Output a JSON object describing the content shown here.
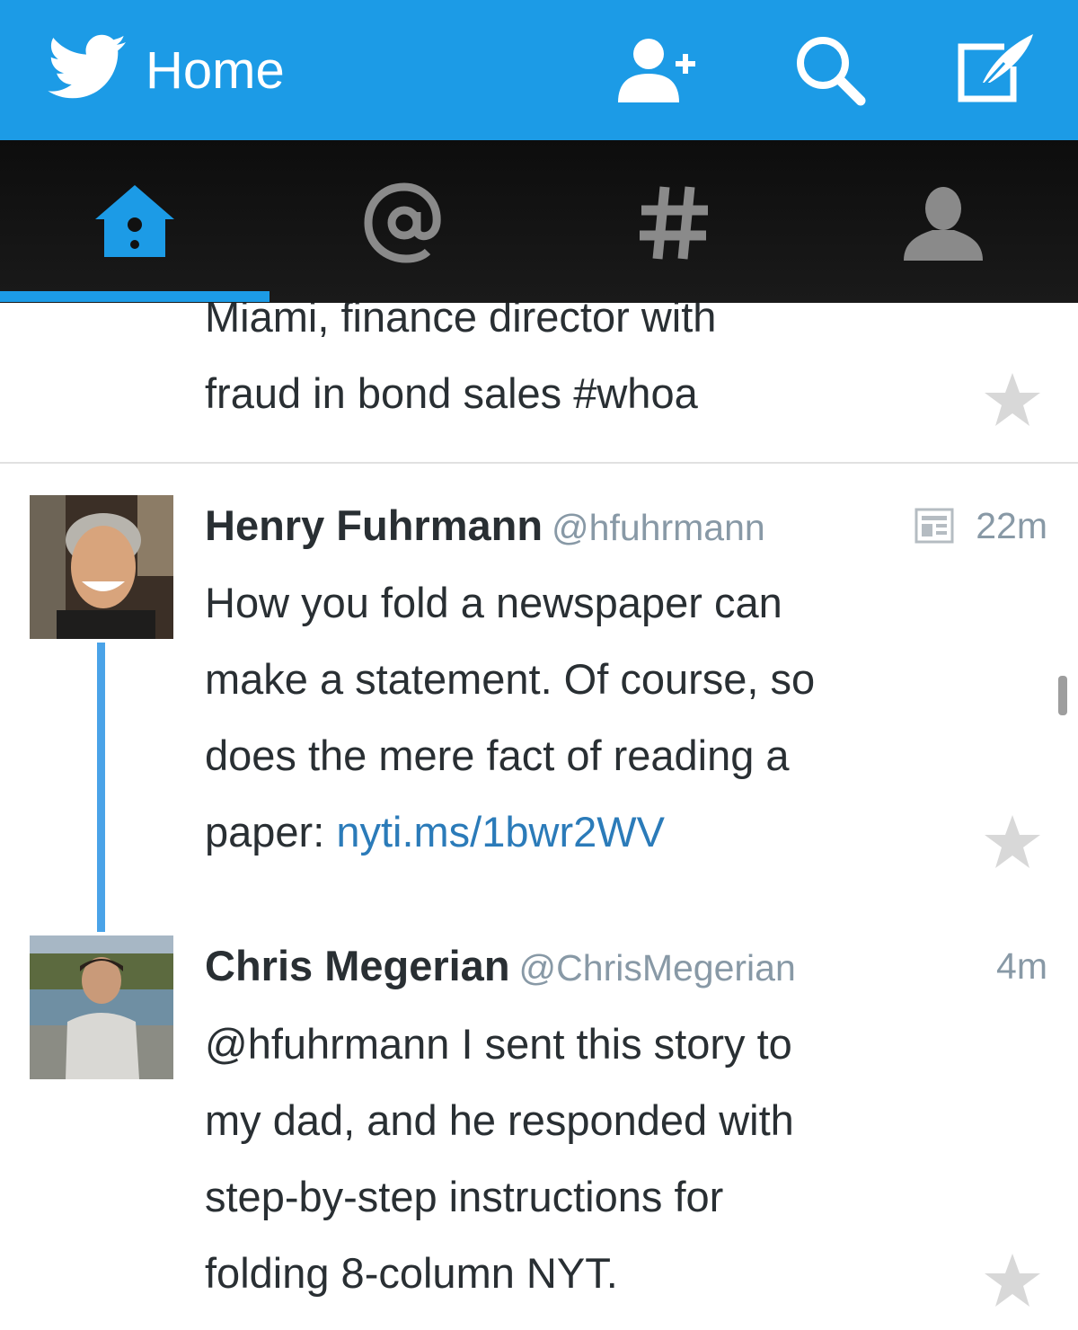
{
  "header": {
    "title": "Home",
    "brand_color": "#1c9be6",
    "icons": [
      "twitter-bird-icon",
      "add-user-icon",
      "search-icon",
      "compose-icon"
    ]
  },
  "tabs": [
    {
      "name": "home",
      "icon": "home-icon",
      "selected": true
    },
    {
      "name": "connect",
      "icon": "at-sign-icon",
      "selected": false
    },
    {
      "name": "discover",
      "icon": "hashtag-icon",
      "selected": false
    },
    {
      "name": "me",
      "icon": "profile-icon",
      "selected": false
    }
  ],
  "tweets": [
    {
      "text_lines": [
        "Miami, finance director with",
        "fraud in bond sales  #whoa"
      ]
    },
    {
      "name": "Henry Fuhrmann",
      "handle": "@hfuhrmann",
      "time": "22m",
      "has_summary_card": true,
      "text_lines": [
        "How you fold a newspaper can",
        "make a statement. Of course, so",
        "does the mere fact of reading a"
      ],
      "text_last_prefix": "paper: ",
      "link": "nyti.ms/1bwr2WV"
    },
    {
      "name": "Chris Megerian",
      "handle": "@ChrisMegerian",
      "time": "4m",
      "text_lines": [
        "@hfuhrmann I sent this story to",
        "my dad, and he responded with",
        "step-by-step instructions for",
        "folding 8-column NYT."
      ]
    }
  ]
}
